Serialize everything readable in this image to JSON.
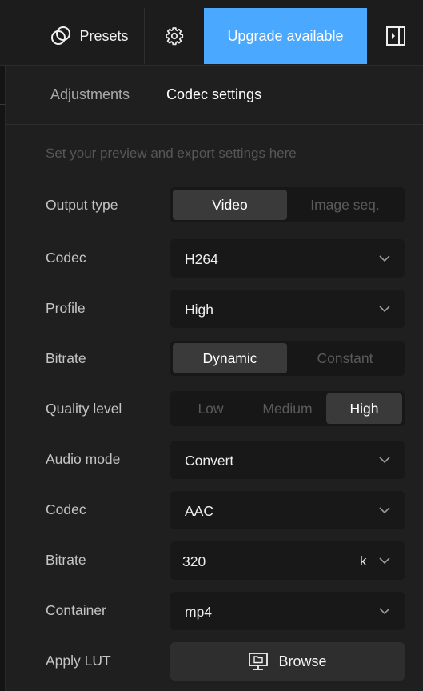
{
  "toolbar": {
    "presets_label": "Presets",
    "upgrade_label": "Upgrade available",
    "icons": {
      "presets": "presets-icon",
      "settings": "gear-icon",
      "panel": "panel-toggle-icon"
    },
    "accent": "#4aa8ff"
  },
  "tabs": [
    {
      "label": "Adjustments",
      "active": false
    },
    {
      "label": "Codec settings",
      "active": true
    }
  ],
  "hint": "Set your preview and export settings here",
  "settings": {
    "output_type": {
      "label": "Output type",
      "options": [
        "Video",
        "Image seq."
      ],
      "selected": "Video"
    },
    "codec": {
      "label": "Codec",
      "value": "H264"
    },
    "profile": {
      "label": "Profile",
      "value": "High"
    },
    "bitrate_mode": {
      "label": "Bitrate",
      "options": [
        "Dynamic",
        "Constant"
      ],
      "selected": "Dynamic"
    },
    "quality_level": {
      "label": "Quality level",
      "options": [
        "Low",
        "Medium",
        "High"
      ],
      "selected": "High"
    },
    "audio_mode": {
      "label": "Audio mode",
      "value": "Convert"
    },
    "audio_codec": {
      "label": "Codec",
      "value": "AAC"
    },
    "audio_bitrate": {
      "label": "Bitrate",
      "value": "320",
      "unit": "k"
    },
    "container": {
      "label": "Container",
      "value": "mp4"
    },
    "apply_lut": {
      "label": "Apply LUT",
      "button": "Browse"
    }
  }
}
